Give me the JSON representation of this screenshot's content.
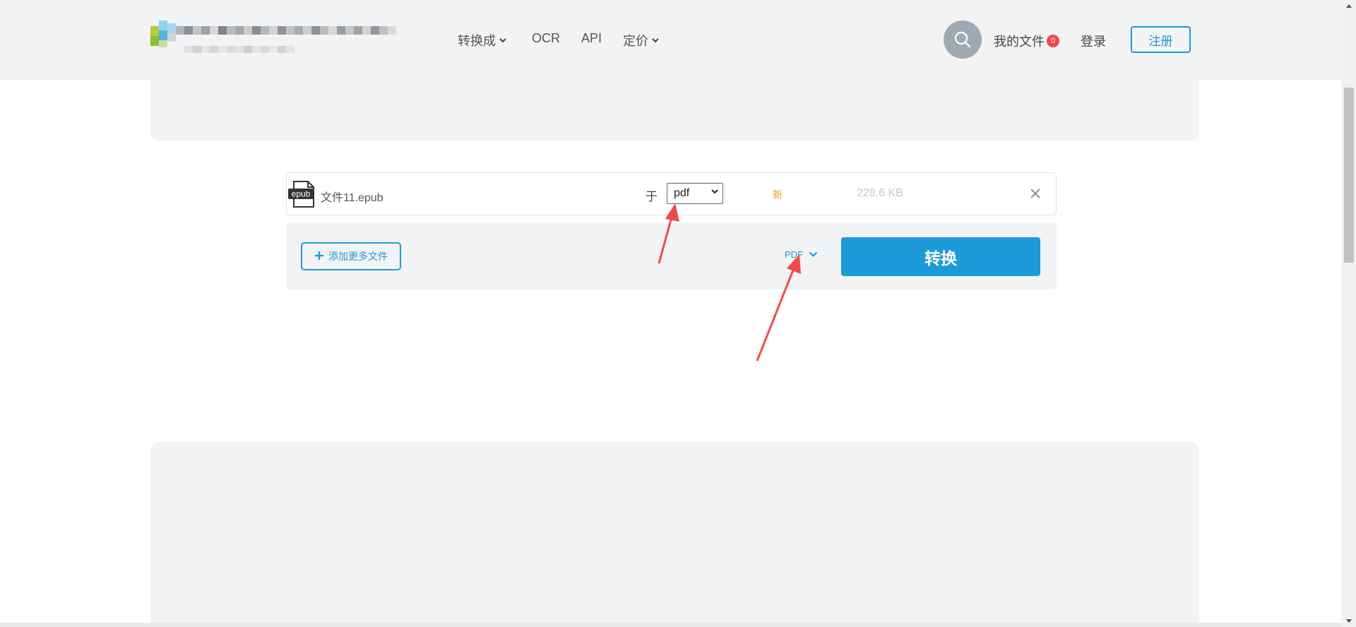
{
  "header": {
    "nav": [
      {
        "label": "转换成",
        "dropdown": true
      },
      {
        "label": "OCR",
        "dropdown": false
      },
      {
        "label": "API",
        "dropdown": false
      },
      {
        "label": "定价",
        "dropdown": true
      }
    ],
    "search_icon": "search-icon",
    "my_files_label": "我的文件",
    "my_files_count": "0",
    "login_label": "登录",
    "register_label": "注册"
  },
  "file": {
    "icon_label": "epub",
    "name": "文件11.epub",
    "to_label": "于",
    "format_value": "pdf",
    "new_label": "新",
    "size": "228.6 KB"
  },
  "actions": {
    "add_more_label": "添加更多文件",
    "convert_all_format": "PDF",
    "convert_label": "转换"
  },
  "colors": {
    "accent": "#1b9bd8",
    "badge": "#f04a4a",
    "new_label": "#e8a21b",
    "annotation_arrow": "#f04a4a",
    "panel_bg": "#f2f3f4"
  }
}
